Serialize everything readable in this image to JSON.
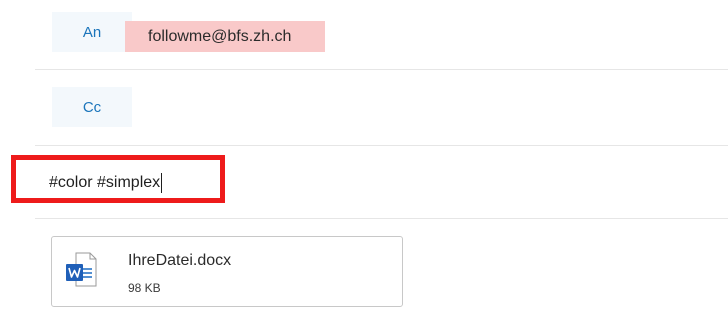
{
  "to": {
    "label": "An",
    "recipient": "followme@bfs.zh.ch"
  },
  "cc": {
    "label": "Cc"
  },
  "subject": {
    "value": "#color #simplex"
  },
  "attachment": {
    "name": "IhreDatei.docx",
    "size": "98 KB",
    "icon": "word-document-icon"
  },
  "colors": {
    "accent": "#1b75bb",
    "highlight": "#f9c9c9",
    "frame": "#ee1b1b"
  }
}
